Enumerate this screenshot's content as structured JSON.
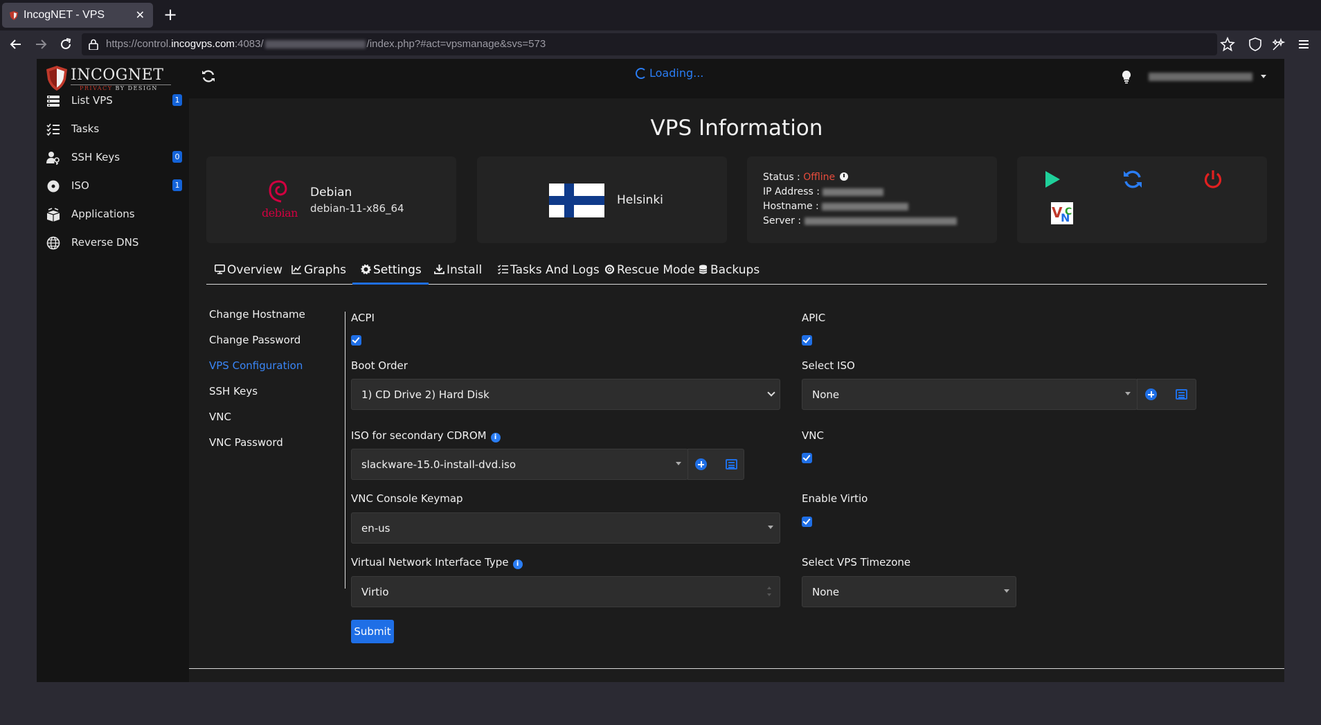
{
  "browser": {
    "tab_title": "IncogNET - VPS",
    "new_tab": "+",
    "close": "✕",
    "url_prefix": "https://control.",
    "url_domain": "incogvps.com",
    "url_port": ":4083/",
    "url_suffix": "/index.php?#act=vpsmanage&svs=573"
  },
  "brand": {
    "name": "INCOGNET",
    "tagline_a": "PRIVACY",
    "tagline_b": "BY DESIGN"
  },
  "sidebar": {
    "items": [
      {
        "label": "List VPS",
        "badge": "1",
        "icon": "server-list-icon"
      },
      {
        "label": "Tasks",
        "badge": "",
        "icon": "task-list-icon"
      },
      {
        "label": "SSH Keys",
        "badge": "0",
        "icon": "user-key-icon"
      },
      {
        "label": "ISO",
        "badge": "1",
        "icon": "disc-icon"
      },
      {
        "label": "Applications",
        "badge": "",
        "icon": "boxes-icon"
      },
      {
        "label": "Reverse DNS",
        "badge": "",
        "icon": "globe-icon"
      }
    ]
  },
  "topbar": {
    "loading": "Loading..."
  },
  "page_title": "VPS Information",
  "os": {
    "name": "Debian",
    "version": "debian-11-x86_64",
    "logo_word": "debian"
  },
  "location": {
    "city": "Helsinki"
  },
  "status": {
    "status_label": "Status : ",
    "status_value": "Offline",
    "ip_label": "IP Address : ",
    "hostname_label": "Hostname : ",
    "server_label": "Server : "
  },
  "controls": {
    "start": "play-icon",
    "restart": "restart-icon",
    "power": "power-icon",
    "vnc": "vnc-icon",
    "vnc_text": "VNC"
  },
  "tabs": [
    {
      "label": "Overview",
      "icon": "monitor-icon"
    },
    {
      "label": "Graphs",
      "icon": "chart-icon"
    },
    {
      "label": "Settings",
      "icon": "gear-icon",
      "active": true
    },
    {
      "label": "Install",
      "icon": "download-icon"
    },
    {
      "label": "Tasks And Logs",
      "icon": "task-list-icon"
    },
    {
      "label": "Rescue Mode",
      "icon": "lifebuoy-icon"
    },
    {
      "label": "Backups",
      "icon": "database-icon"
    }
  ],
  "subnav": [
    {
      "label": "Change Hostname"
    },
    {
      "label": "Change Password"
    },
    {
      "label": "VPS Configuration",
      "active": true
    },
    {
      "label": "SSH Keys"
    },
    {
      "label": "VNC"
    },
    {
      "label": "VNC Password"
    }
  ],
  "form": {
    "acpi_label": "ACPI",
    "acpi_checked": true,
    "apic_label": "APIC",
    "apic_checked": true,
    "boot_order_label": "Boot Order",
    "boot_order_value": "1) CD Drive 2) Hard Disk",
    "select_iso_label": "Select ISO",
    "select_iso_value": "None",
    "iso2_label": "ISO for secondary CDROM",
    "iso2_value": "slackware-15.0-install-dvd.iso",
    "vnc_label": "VNC",
    "vnc_checked": true,
    "keymap_label": "VNC Console Keymap",
    "keymap_value": "en-us",
    "virtio_label": "Enable Virtio",
    "virtio_checked": true,
    "nic_label": "Virtual Network Interface Type",
    "nic_value": "Virtio",
    "timezone_label": "Select VPS Timezone",
    "timezone_value": "None",
    "info_glyph": "i",
    "submit_label": "Submit"
  },
  "colors": {
    "accent": "#1f6fe6",
    "offline": "#e74c3c",
    "play": "#1fd09a",
    "power": "#e02020"
  }
}
